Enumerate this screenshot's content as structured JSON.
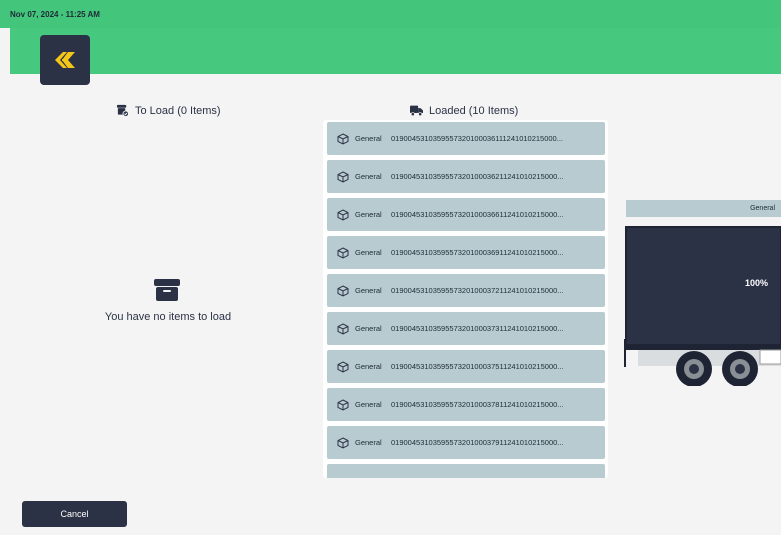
{
  "header": {
    "datetime": "Nov 07, 2024 - 11:25 AM",
    "logo_icon": "gk-logo"
  },
  "to_load": {
    "title": "To Load (0 Items)",
    "icon": "box-check-icon",
    "empty_message": "You have no items to load",
    "empty_icon": "archive-box-icon"
  },
  "loaded": {
    "title": "Loaded (10 Items)",
    "icon": "truck-icon",
    "items": [
      {
        "type": "General",
        "code": "0190045310359557320100036111241010215000..."
      },
      {
        "type": "General",
        "code": "0190045310359557320100036211241010215000..."
      },
      {
        "type": "General",
        "code": "0190045310359557320100036611241010215000..."
      },
      {
        "type": "General",
        "code": "0190045310359557320100036911241010215000..."
      },
      {
        "type": "General",
        "code": "0190045310359557320100037211241010215000..."
      },
      {
        "type": "General",
        "code": "0190045310359557320100037311241010215000..."
      },
      {
        "type": "General",
        "code": "0190045310359557320100037511241010215000..."
      },
      {
        "type": "General",
        "code": "0190045310359557320100037811241010215000..."
      },
      {
        "type": "General",
        "code": "0190045310359557320100037911241010215000..."
      },
      {
        "type": "",
        "code": ""
      }
    ]
  },
  "truck": {
    "label": "General",
    "fill_percent": "100%"
  },
  "footer": {
    "cancel_label": "Cancel"
  },
  "colors": {
    "accent_green": "#46c97f",
    "dark_navy": "#2b3245",
    "item_bg": "#b8cbd0",
    "logo_yellow": "#f5c518"
  }
}
